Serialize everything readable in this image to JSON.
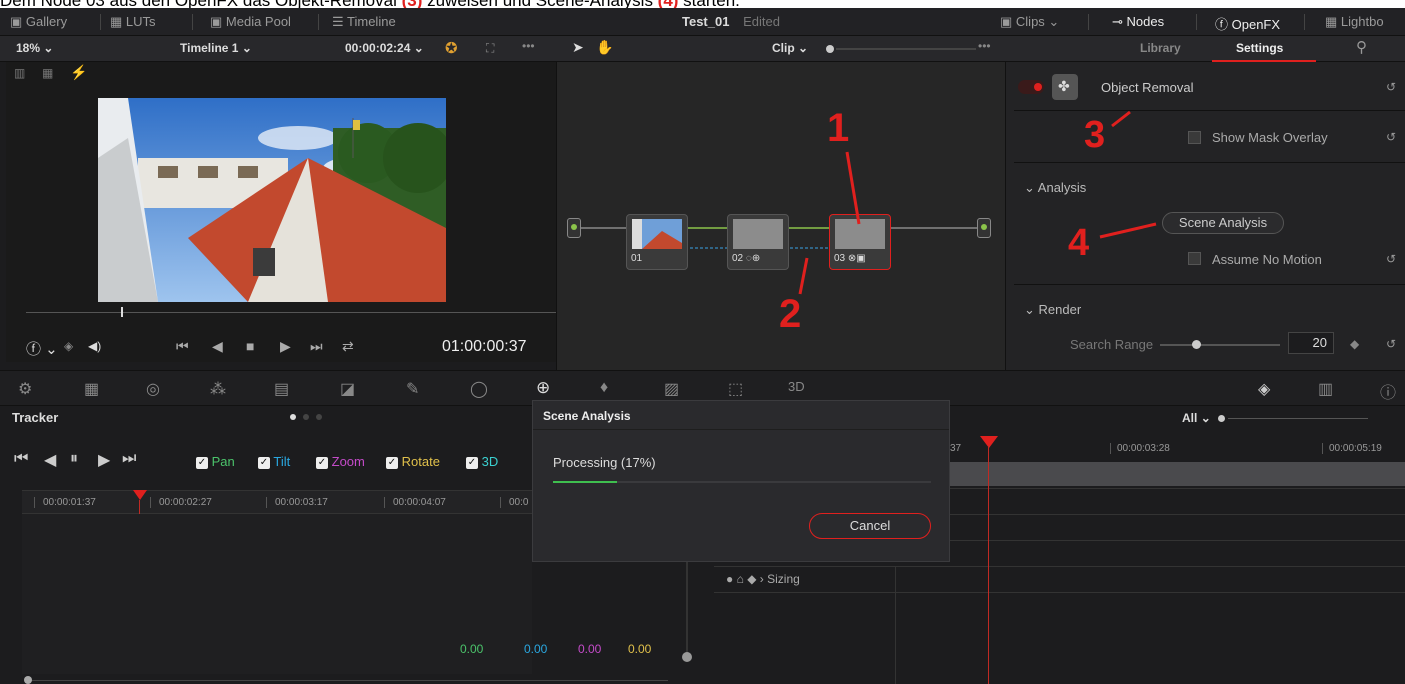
{
  "caption": {
    "prefix": "Dem Node 03 aus den OpenFX das Objekt-Removal ",
    "ref3": "(3)",
    "mid": " zuweisen und Scene-Analysis ",
    "ref4": "(4)",
    "suffix": " starten."
  },
  "topbar": {
    "gallery": "Gallery",
    "luts": "LUTs",
    "media_pool": "Media Pool",
    "timeline": "Timeline",
    "project": "Test_01",
    "project_state": "Edited",
    "clips": "Clips",
    "nodes": "Nodes",
    "openfx": "OpenFX",
    "lightbox": "Lightbo"
  },
  "viewer_bar": {
    "zoom": "18%",
    "timeline_name": "Timeline 1",
    "timecode": "00:00:02:24",
    "clip_mode": "Clip"
  },
  "viewer": {
    "playhead_timecode": "01:00:00:37",
    "scrub_position": 0.18
  },
  "nodes": [
    {
      "label": "01"
    },
    {
      "label": "02"
    },
    {
      "label": "03"
    }
  ],
  "annotations": {
    "n1": "1",
    "n2": "2",
    "n3": "3",
    "n4": "4"
  },
  "settings_panel": {
    "tab_library": "Library",
    "tab_settings": "Settings",
    "fx_name": "Object Removal",
    "show_mask_overlay": "Show Mask Overlay",
    "section_analysis": "Analysis",
    "scene_analysis_button": "Scene Analysis",
    "assume_no_motion": "Assume No Motion",
    "section_render": "Render",
    "search_range_label": "Search Range",
    "search_range_value": "20",
    "search_range_fraction": 0.3
  },
  "tracker": {
    "title": "Tracker",
    "pan": "Pan",
    "tilt": "Tilt",
    "zoom": "Zoom",
    "rotate": "Rotate",
    "three_d": "3D",
    "ruler": [
      "00:00:01:37",
      "00:00:02:27",
      "00:00:03:17",
      "00:00:04:07",
      "00:0"
    ],
    "values": [
      "0.00",
      "0.00",
      "0.00",
      "0.00"
    ]
  },
  "keyframes": {
    "filter": "All",
    "ruler": [
      "37",
      "00:00:03:28",
      "00:00:05:19"
    ],
    "track": "Sizing"
  },
  "dialog": {
    "title": "Scene Analysis",
    "status": "Processing  (17%)",
    "progress": 0.17,
    "cancel": "Cancel"
  },
  "colors": {
    "accent_red": "#e0201e",
    "node_link_green": "#8bc34a",
    "node_link_blue": "#3ba3e6",
    "pan": "#4bc36b",
    "tilt": "#2aa7e0",
    "zoom": "#c44bc9",
    "rotate": "#e0c04b",
    "three_d": "#3ad0d0"
  }
}
